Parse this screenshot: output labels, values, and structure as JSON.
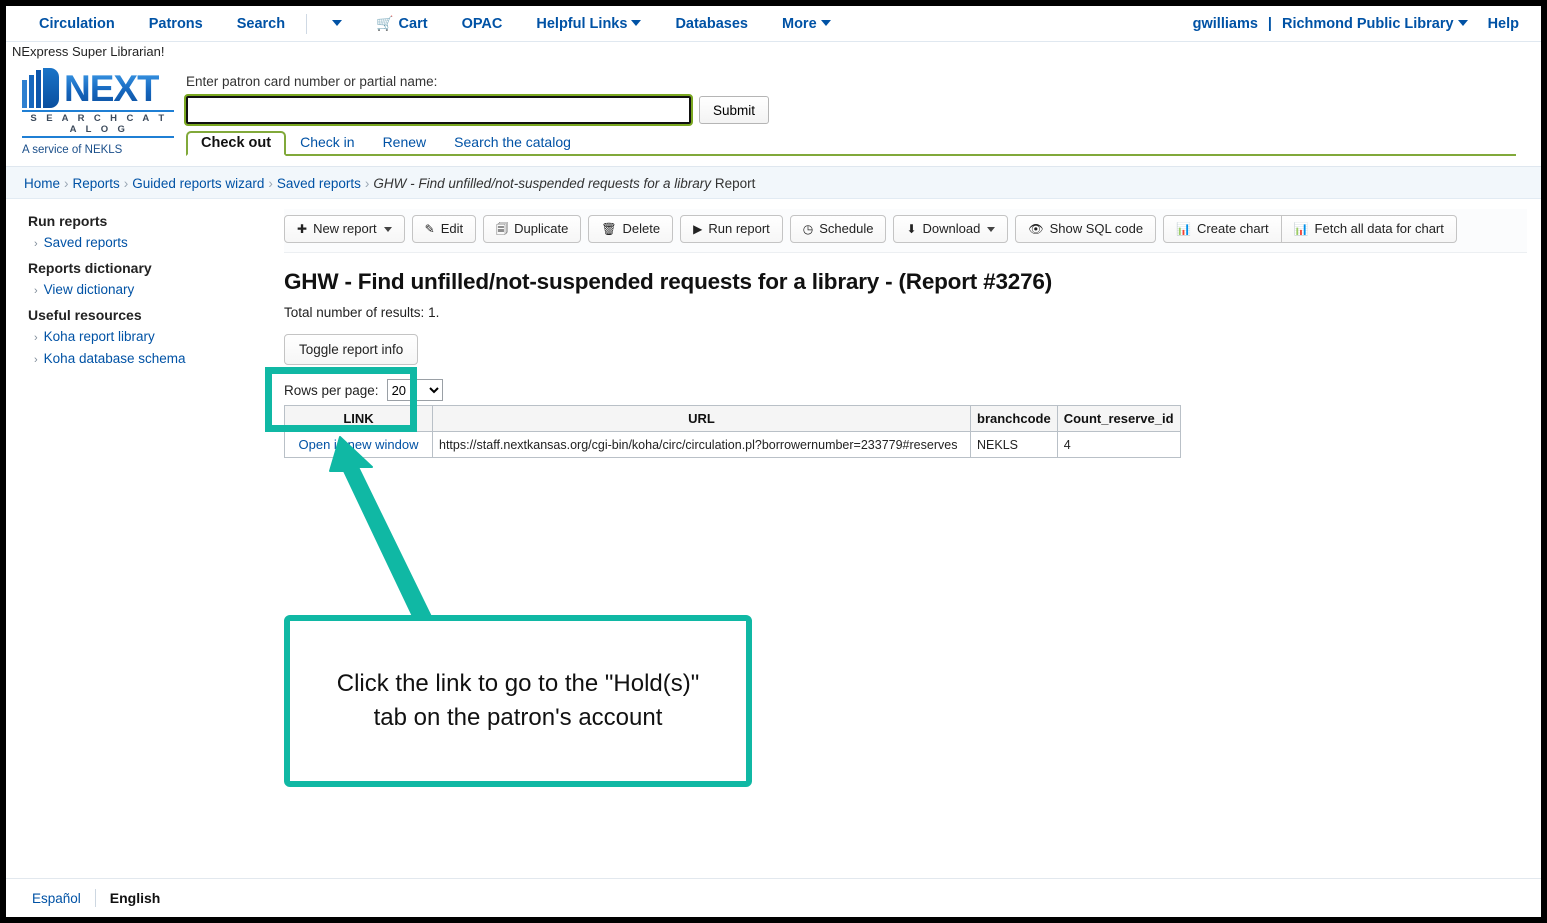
{
  "topnav": {
    "items": [
      {
        "label": "Circulation",
        "icon": ""
      },
      {
        "label": "Patrons",
        "icon": ""
      },
      {
        "label": "Search",
        "icon": ""
      }
    ],
    "more_caret_icon": "chevron-down-icon",
    "cart": {
      "label": "Cart",
      "icon": "shopping-cart-icon"
    },
    "opac": "OPAC",
    "helpful_links": "Helpful Links",
    "databases": "Databases",
    "more": "More",
    "user": "gwilliams",
    "separator": "|",
    "library": "Richmond Public Library",
    "help": "Help"
  },
  "subbrand": "NExpress Super Librarian!",
  "logo": {
    "name": "NEXT",
    "tagline": "S E A R C H   C A T A L O G",
    "service": "A service of NEKLS"
  },
  "search": {
    "label": "Enter patron card number or partial name:",
    "value": "",
    "placeholder": "",
    "submit": "Submit",
    "tabs": [
      {
        "label": "Check out",
        "active": true
      },
      {
        "label": "Check in",
        "active": false
      },
      {
        "label": "Renew",
        "active": false
      },
      {
        "label": "Search the catalog",
        "active": false
      }
    ]
  },
  "breadcrumb": {
    "items": [
      "Home",
      "Reports",
      "Guided reports wizard",
      "Saved reports"
    ],
    "current_italic": "GHW - Find unfilled/not-suspended requests for a library",
    "current_tail": "Report",
    "separator": "›"
  },
  "sidebar": {
    "groups": [
      {
        "heading": "Run reports",
        "items": [
          {
            "label": "Saved reports"
          }
        ]
      },
      {
        "heading": "Reports dictionary",
        "items": [
          {
            "label": "View dictionary"
          }
        ]
      },
      {
        "heading": "Useful resources",
        "items": [
          {
            "label": "Koha report library"
          },
          {
            "label": "Koha database schema"
          }
        ]
      }
    ],
    "chevron": "›"
  },
  "toolbar": {
    "new_report": {
      "label": "New report",
      "icon": "plus-icon",
      "caret": true
    },
    "edit": {
      "label": "Edit",
      "icon": "pencil-icon"
    },
    "duplicate": {
      "label": "Duplicate",
      "icon": "copy-icon"
    },
    "delete": {
      "label": "Delete",
      "icon": "trash-icon"
    },
    "run_report": {
      "label": "Run report",
      "icon": "play-icon"
    },
    "schedule": {
      "label": "Schedule",
      "icon": "clock-icon"
    },
    "download": {
      "label": "Download",
      "icon": "download-icon",
      "caret": true
    },
    "show_sql": {
      "label": "Show SQL code",
      "icon": "eye-icon"
    },
    "create_chart": {
      "label": "Create chart",
      "icon": "bar-chart-icon"
    },
    "fetch_all": {
      "label": "Fetch all data for chart",
      "icon": "bar-chart-icon"
    }
  },
  "report": {
    "title": "GHW - Find unfilled/not-suspended requests for a library - (Report #3276)",
    "total_label": "Total number of results:",
    "total_value": "1.",
    "toggle_info": "Toggle report info",
    "rows_per_page_label": "Rows per page:",
    "rows_per_page_value": "20"
  },
  "table": {
    "headers": [
      "LINK",
      "URL",
      "branchcode",
      "Count_reserve_id"
    ],
    "rows": [
      {
        "link": "Open in new window",
        "url": "https://staff.nextkansas.org/cgi-bin/koha/circ/circulation.pl?borrowernumber=233779#reserves",
        "branchcode": "NEKLS",
        "count_reserve_id": "4"
      }
    ]
  },
  "annotation": {
    "callout_line1": "Click the link to go to the \"Hold(s)\"",
    "callout_line2": "tab on the patron's account",
    "accent_color": "#10b8a4"
  },
  "footer": {
    "spanish": "Español",
    "english": "English"
  }
}
